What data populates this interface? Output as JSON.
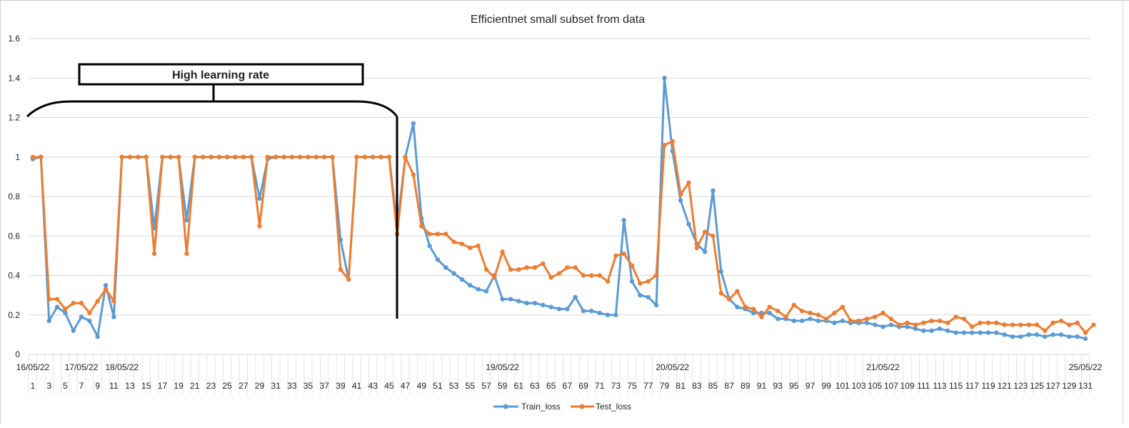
{
  "chart_data": {
    "type": "line",
    "title": "Efficientnet small subset from data",
    "xlabel": "",
    "ylabel": "",
    "ylim": [
      0,
      1.6
    ],
    "y_ticks": [
      "0",
      "0.2",
      "0.4",
      "0.6",
      "0.8",
      "1",
      "1.2",
      "1.4",
      "1.6"
    ],
    "grid": true,
    "legend_position": "bottom",
    "x_count": 131,
    "x_tick_labels_step": 2,
    "date_labels": [
      {
        "at": 1,
        "label": "16/05/22"
      },
      {
        "at": 7,
        "label": "17/05/22"
      },
      {
        "at": 12,
        "label": "18/05/22"
      },
      {
        "at": 59,
        "label": "19/05/22"
      },
      {
        "at": 80,
        "label": "20/05/22"
      },
      {
        "at": 106,
        "label": "21/05/22"
      },
      {
        "at": 131,
        "label": "25/05/22"
      }
    ],
    "annotation": {
      "label": "High learning rate",
      "from_x": 1,
      "to_x": 46
    },
    "series": [
      {
        "name": "Train_loss",
        "color": "#5b9bd5",
        "values": [
          0.99,
          1.0,
          0.17,
          0.24,
          0.21,
          0.12,
          0.19,
          0.17,
          0.09,
          0.35,
          0.19,
          1.0,
          1.0,
          1.0,
          1.0,
          0.64,
          1.0,
          1.0,
          1.0,
          0.68,
          1.0,
          1.0,
          1.0,
          1.0,
          1.0,
          1.0,
          1.0,
          1.0,
          0.79,
          0.99,
          1.0,
          1.0,
          1.0,
          1.0,
          1.0,
          1.0,
          1.0,
          1.0,
          0.58,
          0.38,
          1.0,
          1.0,
          1.0,
          1.0,
          1.0,
          0.65,
          1.0,
          1.17,
          0.69,
          0.55,
          0.48,
          0.44,
          0.41,
          0.38,
          0.35,
          0.33,
          0.32,
          0.4,
          0.28,
          0.28,
          0.27,
          0.26,
          0.26,
          0.25,
          0.24,
          0.23,
          0.23,
          0.29,
          0.22,
          0.22,
          0.21,
          0.2,
          0.2,
          0.68,
          0.37,
          0.3,
          0.29,
          0.25,
          1.4,
          1.03,
          0.78,
          0.66,
          0.56,
          0.52,
          0.83,
          0.42,
          0.28,
          0.24,
          0.23,
          0.21,
          0.21,
          0.21,
          0.18,
          0.18,
          0.17,
          0.17,
          0.18,
          0.17,
          0.17,
          0.16,
          0.17,
          0.16,
          0.16,
          0.16,
          0.15,
          0.14,
          0.15,
          0.14,
          0.14,
          0.13,
          0.12,
          0.12,
          0.13,
          0.12,
          0.11,
          0.11,
          0.11,
          0.11,
          0.11,
          0.11,
          0.1,
          0.09,
          0.09,
          0.1,
          0.1,
          0.09,
          0.1,
          0.1,
          0.09,
          0.09,
          0.08
        ]
      },
      {
        "name": "Test_loss",
        "color": "#ed7d31",
        "values": [
          1.0,
          1.0,
          0.28,
          0.28,
          0.23,
          0.26,
          0.26,
          0.21,
          0.27,
          0.33,
          0.27,
          1.0,
          1.0,
          1.0,
          1.0,
          0.51,
          1.0,
          1.0,
          1.0,
          0.51,
          1.0,
          1.0,
          1.0,
          1.0,
          1.0,
          1.0,
          1.0,
          1.0,
          0.65,
          1.0,
          1.0,
          1.0,
          1.0,
          1.0,
          1.0,
          1.0,
          1.0,
          1.0,
          0.43,
          0.38,
          1.0,
          1.0,
          1.0,
          1.0,
          1.0,
          0.61,
          1.0,
          0.91,
          0.65,
          0.61,
          0.61,
          0.61,
          0.57,
          0.56,
          0.54,
          0.55,
          0.43,
          0.39,
          0.52,
          0.43,
          0.43,
          0.44,
          0.44,
          0.46,
          0.39,
          0.41,
          0.44,
          0.44,
          0.4,
          0.4,
          0.4,
          0.37,
          0.5,
          0.51,
          0.45,
          0.36,
          0.37,
          0.4,
          1.06,
          1.08,
          0.81,
          0.87,
          0.54,
          0.62,
          0.6,
          0.31,
          0.28,
          0.32,
          0.24,
          0.23,
          0.19,
          0.24,
          0.22,
          0.19,
          0.25,
          0.22,
          0.21,
          0.2,
          0.18,
          0.21,
          0.24,
          0.17,
          0.17,
          0.18,
          0.19,
          0.21,
          0.18,
          0.15,
          0.16,
          0.15,
          0.16,
          0.17,
          0.17,
          0.16,
          0.19,
          0.18,
          0.14,
          0.16,
          0.16,
          0.16,
          0.15,
          0.15,
          0.15,
          0.15,
          0.15,
          0.12,
          0.16,
          0.17,
          0.15,
          0.16,
          0.11,
          0.15
        ]
      }
    ]
  }
}
